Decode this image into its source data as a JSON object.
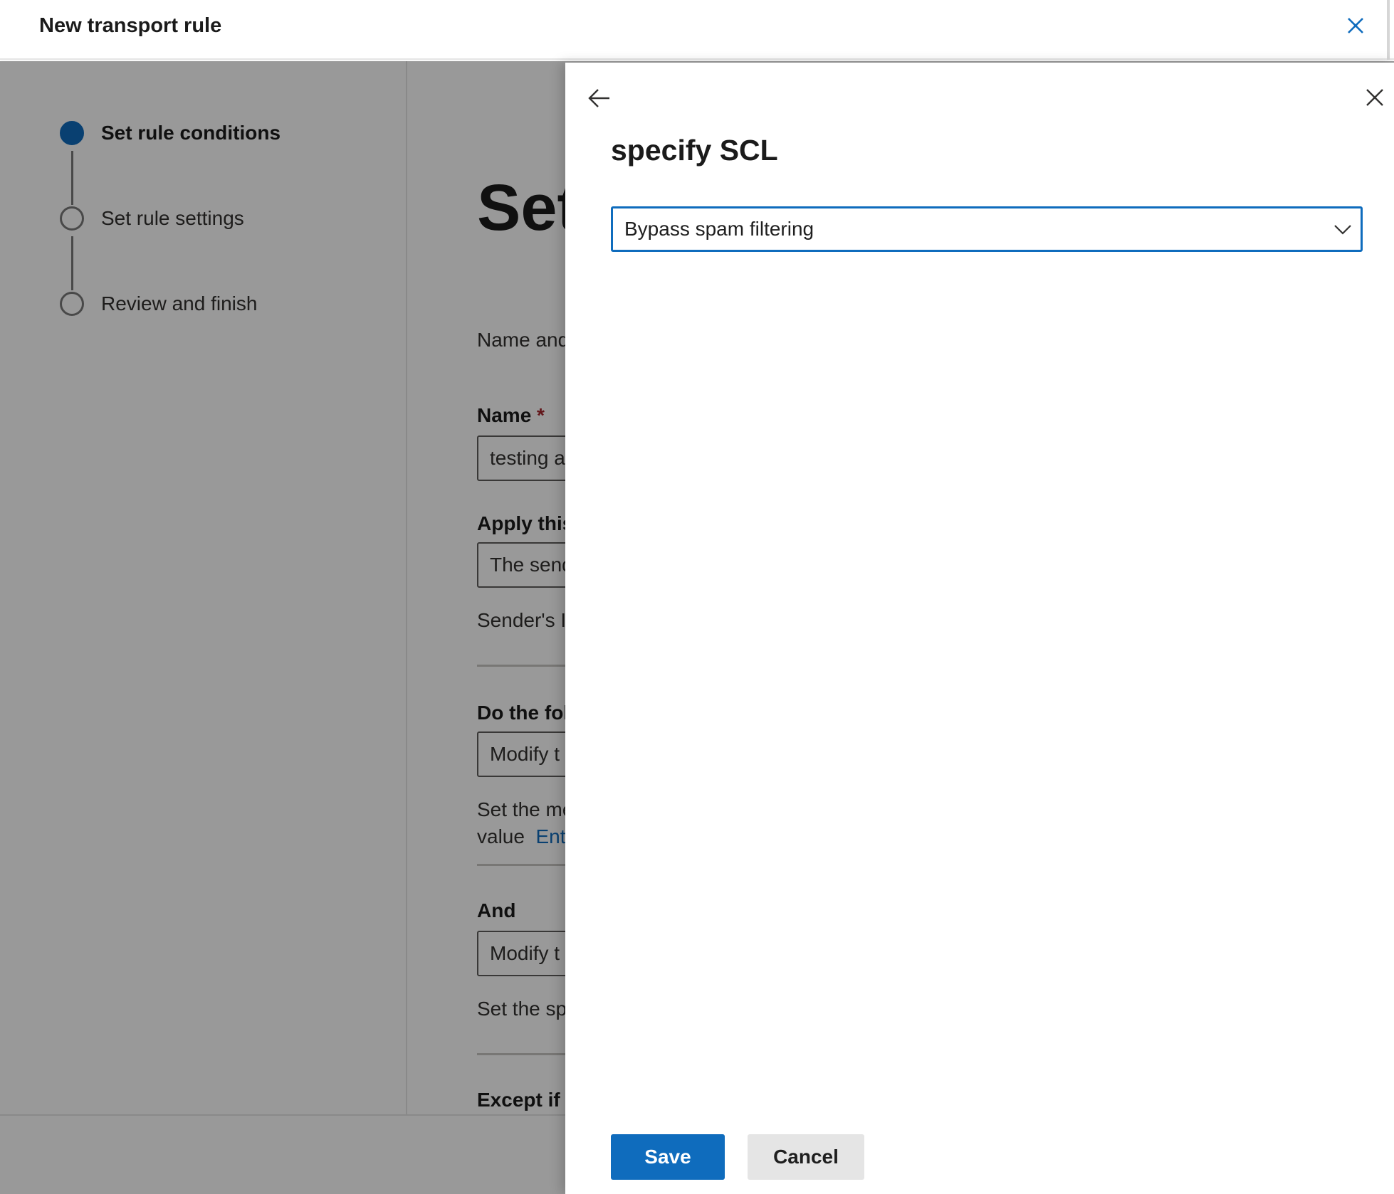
{
  "header": {
    "title": "New transport rule",
    "close_icon": "close-icon"
  },
  "stepper": {
    "steps": [
      {
        "label": "Set rule conditions",
        "state": "active"
      },
      {
        "label": "Set rule settings",
        "state": "pending"
      },
      {
        "label": "Review and finish",
        "state": "pending"
      }
    ]
  },
  "background_form": {
    "heading": "Set",
    "description": "Name and",
    "name_label": "Name",
    "name_required_marker": "*",
    "name_value": "testing a",
    "apply_label": "Apply this",
    "apply_value": "The send",
    "apply_detail": "Sender's IP",
    "do_label": "Do the fol",
    "do_value": "Modify t",
    "do_detail_line1": "Set the me",
    "do_detail_line2_text": "value",
    "do_detail_line2_link": "Ente",
    "and_label": "And",
    "and_value": "Modify t",
    "and_detail": "Set the sp",
    "except_label": "Except if"
  },
  "panel": {
    "back_icon": "arrow-left-icon",
    "close_icon": "close-icon",
    "title": "specify SCL",
    "dropdown": {
      "selected": "Bypass spam filtering",
      "icon": "chevron-down-icon"
    },
    "save_label": "Save",
    "cancel_label": "Cancel"
  },
  "colors": {
    "accent": "#0f6cbd",
    "required": "#a4262c",
    "overlay": "rgba(0,0,0,0.4)"
  }
}
